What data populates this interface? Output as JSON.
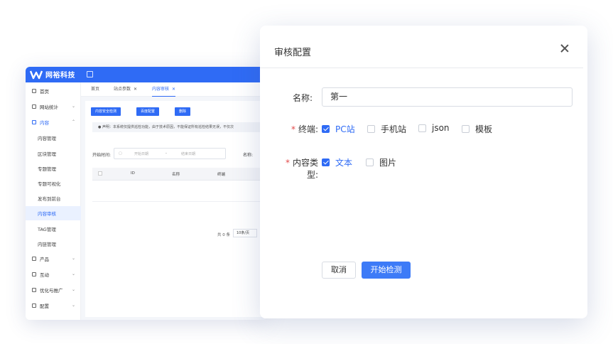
{
  "app": {
    "brand": "网裕科技",
    "sidebar": {
      "items": [
        {
          "label": "首页"
        },
        {
          "label": "网站统计"
        },
        {
          "label": "内容"
        },
        {
          "label": "内容管理"
        },
        {
          "label": "区块管理"
        },
        {
          "label": "专题管理"
        },
        {
          "label": "专题可视化"
        },
        {
          "label": "发布到前台"
        },
        {
          "label": "内容审核"
        },
        {
          "label": "TAG管理"
        },
        {
          "label": "内链管理"
        },
        {
          "label": "产品"
        },
        {
          "label": "互动"
        },
        {
          "label": "优化与推广"
        },
        {
          "label": "配置"
        }
      ]
    },
    "tabs": [
      {
        "label": "首页"
      },
      {
        "label": "站点参数"
      },
      {
        "label": "内容审核"
      }
    ],
    "toolbar": {
      "btn1": "内容安全检测",
      "btn2": "百度配置",
      "btn3": "删除"
    },
    "notice": "声明：本系统仅提供巡检功能，由于技术原因，不能保证所有巡检结果无误，不仅次",
    "filters": {
      "start_label": "开始时间:",
      "start_placeholder": "开始日期",
      "sep": "-",
      "end_placeholder": "结束日期",
      "name_label": "名称:"
    },
    "table": {
      "headers": [
        "ID",
        "名称",
        "终端"
      ]
    },
    "pager": {
      "total": "共 0 条",
      "size": "10条/页"
    }
  },
  "modal": {
    "title": "审核配置",
    "name_label": "名称:",
    "name_value": "第一",
    "terminal_label": "终端:",
    "terminals": [
      {
        "label": "PC站",
        "checked": true
      },
      {
        "label": "手机站",
        "checked": false
      },
      {
        "label": "json",
        "checked": false
      },
      {
        "label": "模板",
        "checked": false
      }
    ],
    "content_type_label": "内容类型:",
    "content_types": [
      {
        "label": "文本",
        "checked": true
      },
      {
        "label": "图片",
        "checked": false
      }
    ],
    "cancel_label": "取消",
    "start_label": "开始检测"
  },
  "colors": {
    "accent": "#2f6bf5",
    "required": "#e24a4a"
  }
}
